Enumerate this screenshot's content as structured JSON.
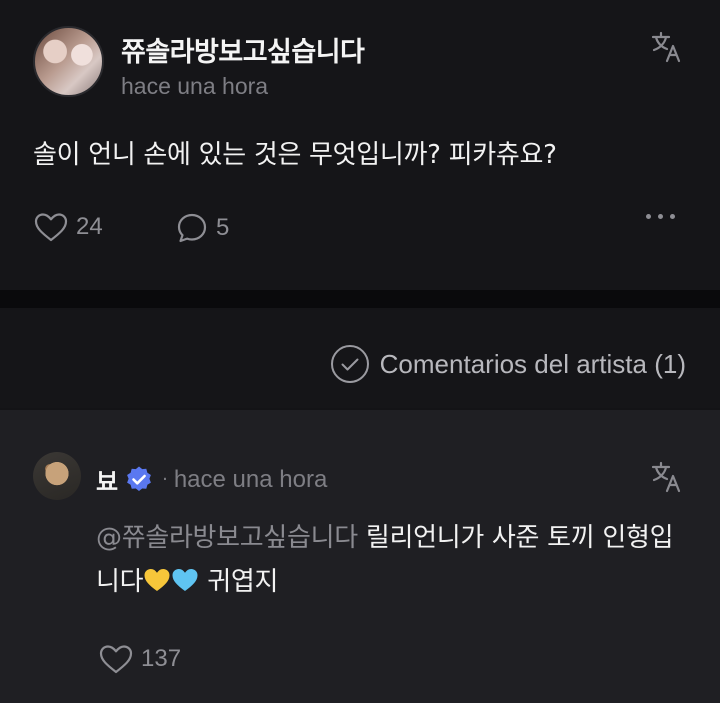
{
  "post": {
    "author": "쮸솔라방보고싶습니다",
    "time": "hace una hora",
    "body": "솔이 언니 손에 있는 것은 무엇입니까? 피카츄요?",
    "likes": "24",
    "comments": "5"
  },
  "artist_bar": {
    "label": "Comentarios del artista (1)"
  },
  "reply": {
    "name": "뵤",
    "dot": "·",
    "time": "hace una hora",
    "mention": "@쮸솔라방보고싶습니다",
    "text_part1": " 릴리언니가 사준 토끼 인형입니다",
    "text_part2": " 귀엽지",
    "likes": "137"
  },
  "colors": {
    "background": "#151518",
    "reply_background": "#1f1f23",
    "muted_text": "#7e7e84",
    "verified_badge": "#5a78f0"
  },
  "icons": [
    "translate-icon",
    "heart-icon",
    "comment-icon",
    "more-icon",
    "check-circle-icon",
    "verified-badge-icon",
    "yellow-heart-emoji",
    "blue-heart-emoji"
  ]
}
